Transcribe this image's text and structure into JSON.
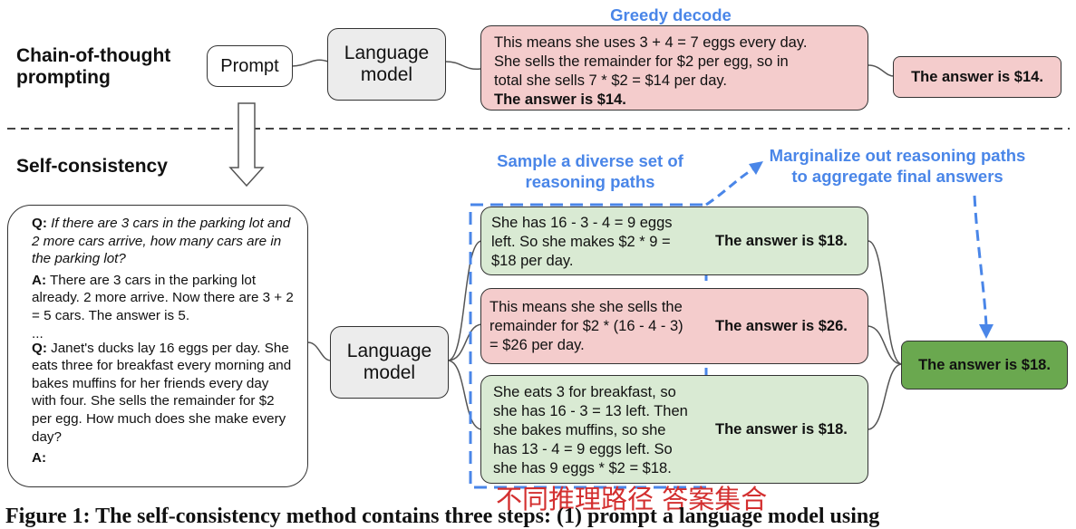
{
  "top": {
    "label": "Chain-of-thought prompting",
    "prompt": "Prompt",
    "model": "Language model",
    "method": "Greedy decode",
    "reasoning": [
      "This means she uses 3 + 4 = 7 eggs every day.",
      "She sells the remainder for $2 per egg, so in",
      "total she sells 7 * $2 = $14 per day."
    ],
    "reasoning_answer": "The answer is $14.",
    "answer": "The answer is $14."
  },
  "bottom": {
    "label": "Self-consistency",
    "model": "Language model",
    "sample_label": "Sample a diverse set of reasoning paths",
    "marginalize_label": "Marginalize out reasoning paths to aggregate final answers",
    "prompt": {
      "q1_label": "Q:",
      "q1": "If there are 3 cars in the parking lot and 2 more cars arrive, how many cars are in the parking lot?",
      "a1_label": "A:",
      "a1": "There are 3 cars in the parking lot already. 2 more arrive. Now there are 3 + 2 = 5 cars. The answer is 5.",
      "ellipsis": "...",
      "q2_label": "Q:",
      "q2": "Janet's ducks lay 16 eggs per day. She eats three for breakfast every morning and bakes muffins for her friends every day with four. She sells the remainder for $2 per egg. How much does she make every day?",
      "a2_label": "A:"
    },
    "paths": [
      {
        "lines": [
          "She has 16 - 3 - 4 = 9 eggs",
          "left. So she makes $2 * 9 =",
          "$18 per day."
        ],
        "answer": "The answer is $18.",
        "status": "correct"
      },
      {
        "lines": [
          "This means she she sells the",
          "remainder for $2 * (16 - 4 - 3)",
          "= $26 per day."
        ],
        "answer": "The answer is $26.",
        "status": "incorrect"
      },
      {
        "lines": [
          "She eats 3 for breakfast, so",
          "she has 16 - 3 = 13 left. Then",
          "she bakes muffins, so she",
          "has 13 - 4 = 9 eggs left. So",
          "she has 9 eggs * $2 = $18."
        ],
        "answer": "The answer is $18.",
        "status": "correct"
      }
    ],
    "final_answer": "The answer is $18."
  },
  "annotation": "不同推理路径   答案集合",
  "caption": "Figure 1:  The self-consistency method contains three steps:  (1) prompt a language model using"
}
